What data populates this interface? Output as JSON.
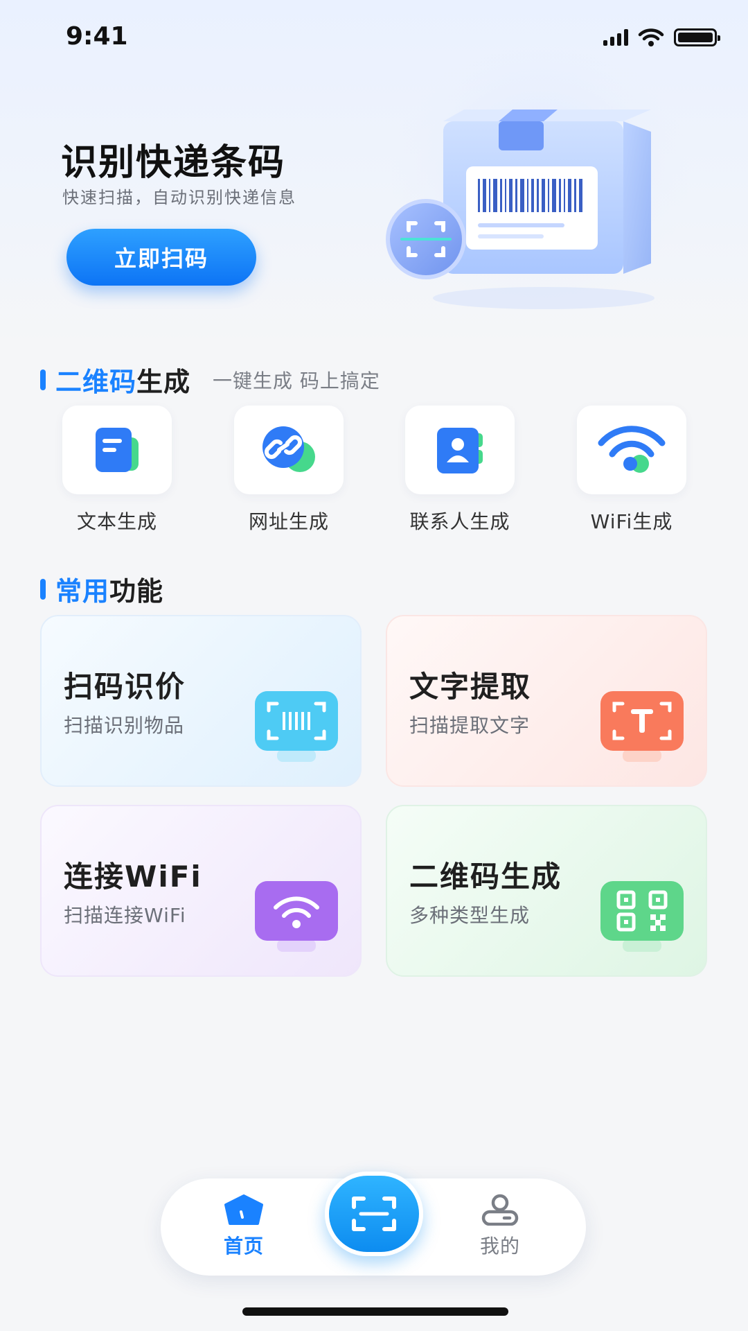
{
  "status_bar": {
    "time": "9:41"
  },
  "hero": {
    "title": "识别快递条码",
    "subtitle": "快速扫描，自动识别快递信息",
    "button_label": "立即扫码"
  },
  "qr_section": {
    "title_highlight": "二维码",
    "title_rest": "生成",
    "description": "一键生成 码上搞定",
    "items": [
      {
        "label": "文本生成",
        "icon": "text-doc-icon"
      },
      {
        "label": "网址生成",
        "icon": "link-icon"
      },
      {
        "label": "联系人生成",
        "icon": "contact-icon"
      },
      {
        "label": "WiFi生成",
        "icon": "wifi-icon"
      }
    ]
  },
  "common_section": {
    "title_highlight": "常用",
    "title_rest": "功能",
    "cards": [
      {
        "title": "扫码识价",
        "subtitle": "扫描识别物品",
        "icon": "barcode-scan-icon",
        "color": "#3fc3f5"
      },
      {
        "title": "文字提取",
        "subtitle": "扫描提取文字",
        "icon": "text-extract-icon",
        "color": "#f97a5c"
      },
      {
        "title": "连接WiFi",
        "subtitle": "扫描连接WiFi",
        "icon": "wifi-connect-icon",
        "color": "#a86cf0"
      },
      {
        "title": "二维码生成",
        "subtitle": "多种类型生成",
        "icon": "qr-code-icon",
        "color": "#5ed68a"
      }
    ]
  },
  "tab_bar": {
    "home_label": "首页",
    "mine_label": "我的",
    "active": "首页"
  },
  "colors": {
    "accent": "#1a82ff",
    "background": "#f5f6f8"
  }
}
